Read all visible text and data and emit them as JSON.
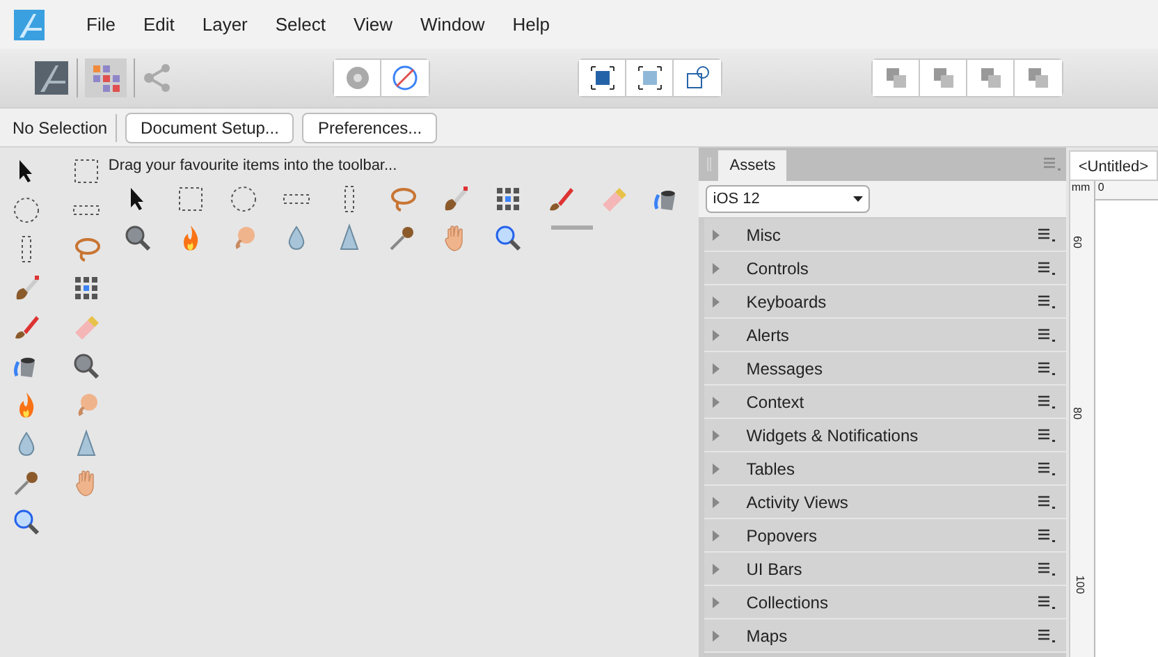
{
  "menu": [
    "File",
    "Edit",
    "Layer",
    "Select",
    "View",
    "Window",
    "Help"
  ],
  "context_bar": {
    "status": "No Selection",
    "buttons": [
      "Document Setup...",
      "Preferences..."
    ]
  },
  "customize_hint": "Drag your favourite items into the toolbar...",
  "assets_panel": {
    "tabs": [
      {
        "label": "Assets",
        "selected": true
      }
    ],
    "category_select": "iOS 12",
    "categories": [
      {
        "label": "Misc",
        "expanded": false
      },
      {
        "label": "Controls",
        "expanded": false
      },
      {
        "label": "Keyboards",
        "expanded": false
      },
      {
        "label": "Alerts",
        "expanded": false
      },
      {
        "label": "Messages",
        "expanded": false
      },
      {
        "label": "Context",
        "expanded": false
      },
      {
        "label": "Widgets & Notifications",
        "expanded": false
      },
      {
        "label": "Tables",
        "expanded": false
      },
      {
        "label": "Activity Views",
        "expanded": false
      },
      {
        "label": "Popovers",
        "expanded": false
      },
      {
        "label": "UI Bars",
        "expanded": false
      },
      {
        "label": "Collections",
        "expanded": false
      },
      {
        "label": "Maps",
        "expanded": false
      }
    ]
  },
  "document": {
    "tab": "<Untitled>",
    "ruler_unit": "mm",
    "top_ruler_labels": [
      "0"
    ],
    "side_ruler_labels": [
      "60",
      "80",
      "100"
    ]
  }
}
